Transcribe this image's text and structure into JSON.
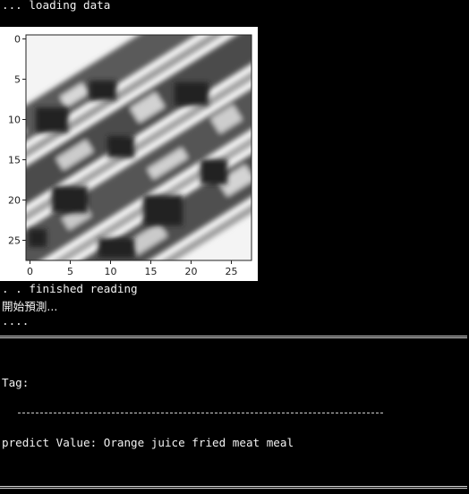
{
  "console": {
    "loading": "... loading data",
    "finished": ". . finished reading",
    "start_predict": "開始預測...",
    "dots": "....",
    "tag_label": "Tag:",
    "predict_line": "predict Value: Orange juice fried meat meal"
  },
  "figure": {
    "y_ticks": [
      "0",
      "5",
      "10",
      "15",
      "20",
      "25"
    ],
    "x_ticks": [
      "0",
      "5",
      "10",
      "15",
      "20",
      "25"
    ],
    "image_size": 28
  }
}
